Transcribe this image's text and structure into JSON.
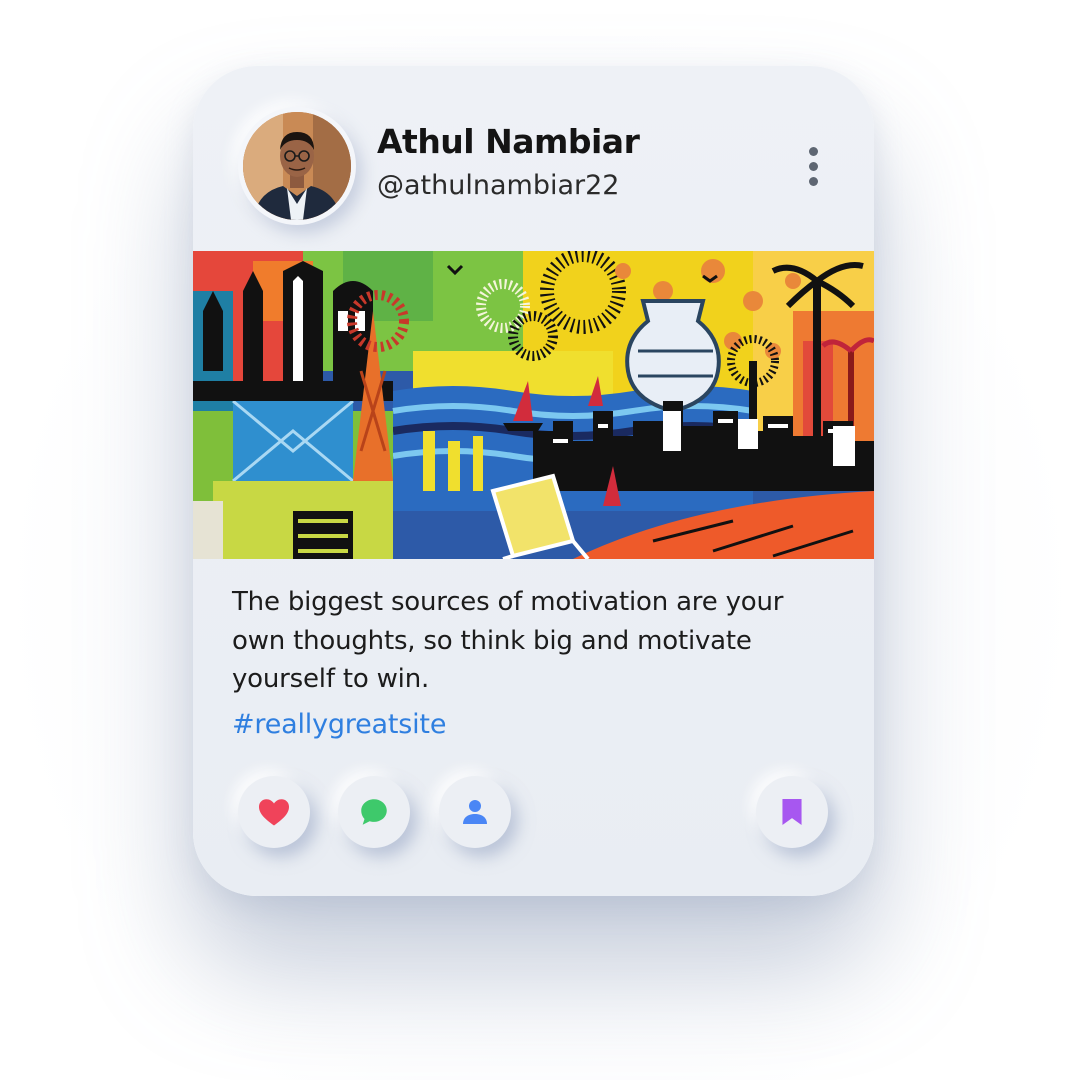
{
  "post": {
    "author": {
      "name": "Athul Nambiar",
      "handle": "@athulnambiar22"
    },
    "caption": "The biggest sources of motivation are your own thoughts, so think big and motivate yourself to win.",
    "hashtag": "#reallygreatsite",
    "image": {
      "subject": "colorful mural"
    }
  },
  "actions": {
    "like": {
      "icon": "heart-icon",
      "color": "#f0435a"
    },
    "comment": {
      "icon": "chat-bubble-icon",
      "color": "#3ec96b"
    },
    "follow": {
      "icon": "user-icon",
      "color": "#4a86f5"
    },
    "save": {
      "icon": "bookmark-icon",
      "color": "#a757f0"
    }
  },
  "colors": {
    "hashtag": "#2f7fe0",
    "card_background": "#eef1f6"
  }
}
